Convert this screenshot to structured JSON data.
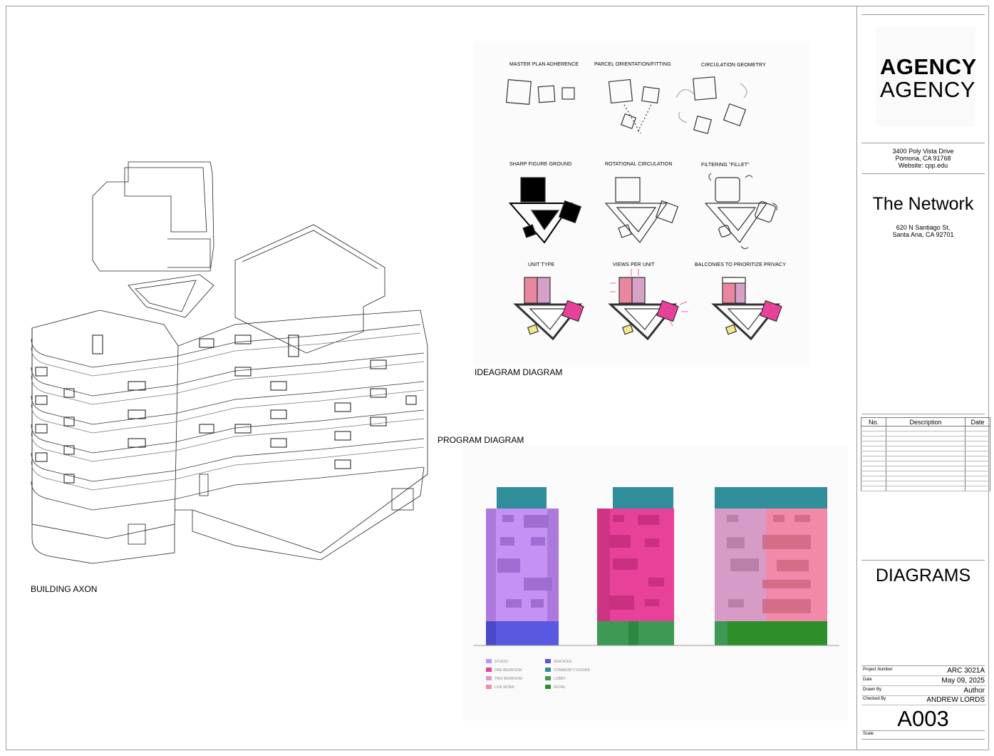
{
  "titleblock": {
    "logo_line1": "AGENCY",
    "logo_line2": "AGENCY",
    "address_line1": "3400 Poly Vista Drive",
    "address_line2": "Pomona, CA 91768",
    "address_line3": "Website: cpp.edu",
    "project_name": "The Network",
    "project_address_line1": "620 N Santiago St,",
    "project_address_line2": "Santa Ana, CA 92701",
    "revision_headers": [
      "No.",
      "Description",
      "Date"
    ],
    "sheet_name": "DIAGRAMS",
    "info": [
      {
        "label": "Project Number",
        "value": "ARC 3021A"
      },
      {
        "label": "Date",
        "value": "May 09, 2025"
      },
      {
        "label": "Drawn By",
        "value": "Author"
      },
      {
        "label": "Checked By",
        "value": "ANDREW LORDS"
      }
    ],
    "sheet_number": "A003",
    "scale_label": "Scale"
  },
  "labels": {
    "building_axon": "BUILDING AXON",
    "ideagram": "IDEAGRAM DIAGRAM",
    "program": "PROGRAM DIAGRAM"
  },
  "ideagram_captions": [
    "MASTER PLAN ADHERENCE",
    "PARCEL ORIENTATION/FITTING",
    "CIRCULATION GEOMETRY",
    "SHARP FIGURE GROUND",
    "ROTATIONAL CIRCULATION",
    "FILTERING \"FILLET\"",
    "UNIT TYPE",
    "VIEWS PER UNIT",
    "BALCONIES TO PRIORITIZE PRIVACY"
  ],
  "program_legend": [
    {
      "label": "STUDIO",
      "color": "#c591f2"
    },
    {
      "label": "ONE BEDROOM",
      "color": "#e8419a"
    },
    {
      "label": "TWO BEDROOM",
      "color": "#d79bc8"
    },
    {
      "label": "LIVE WORK",
      "color": "#f08aa8"
    },
    {
      "label": "SERVICES",
      "color": "#5858e0"
    },
    {
      "label": "COMMUNITY ROOMS",
      "color": "#2f8e99"
    },
    {
      "label": "LOBBY",
      "color": "#3c9a55"
    },
    {
      "label": "RETAIL",
      "color": "#2e8f2a"
    }
  ],
  "colors": {
    "studio": "#c591f2",
    "one_bed": "#e8419a",
    "two_bed": "#d79bc8",
    "live_work": "#f08aa8",
    "services": "#5858e0",
    "community": "#2f8e99",
    "lobby": "#3c9a55",
    "retail": "#2e8f2a"
  }
}
